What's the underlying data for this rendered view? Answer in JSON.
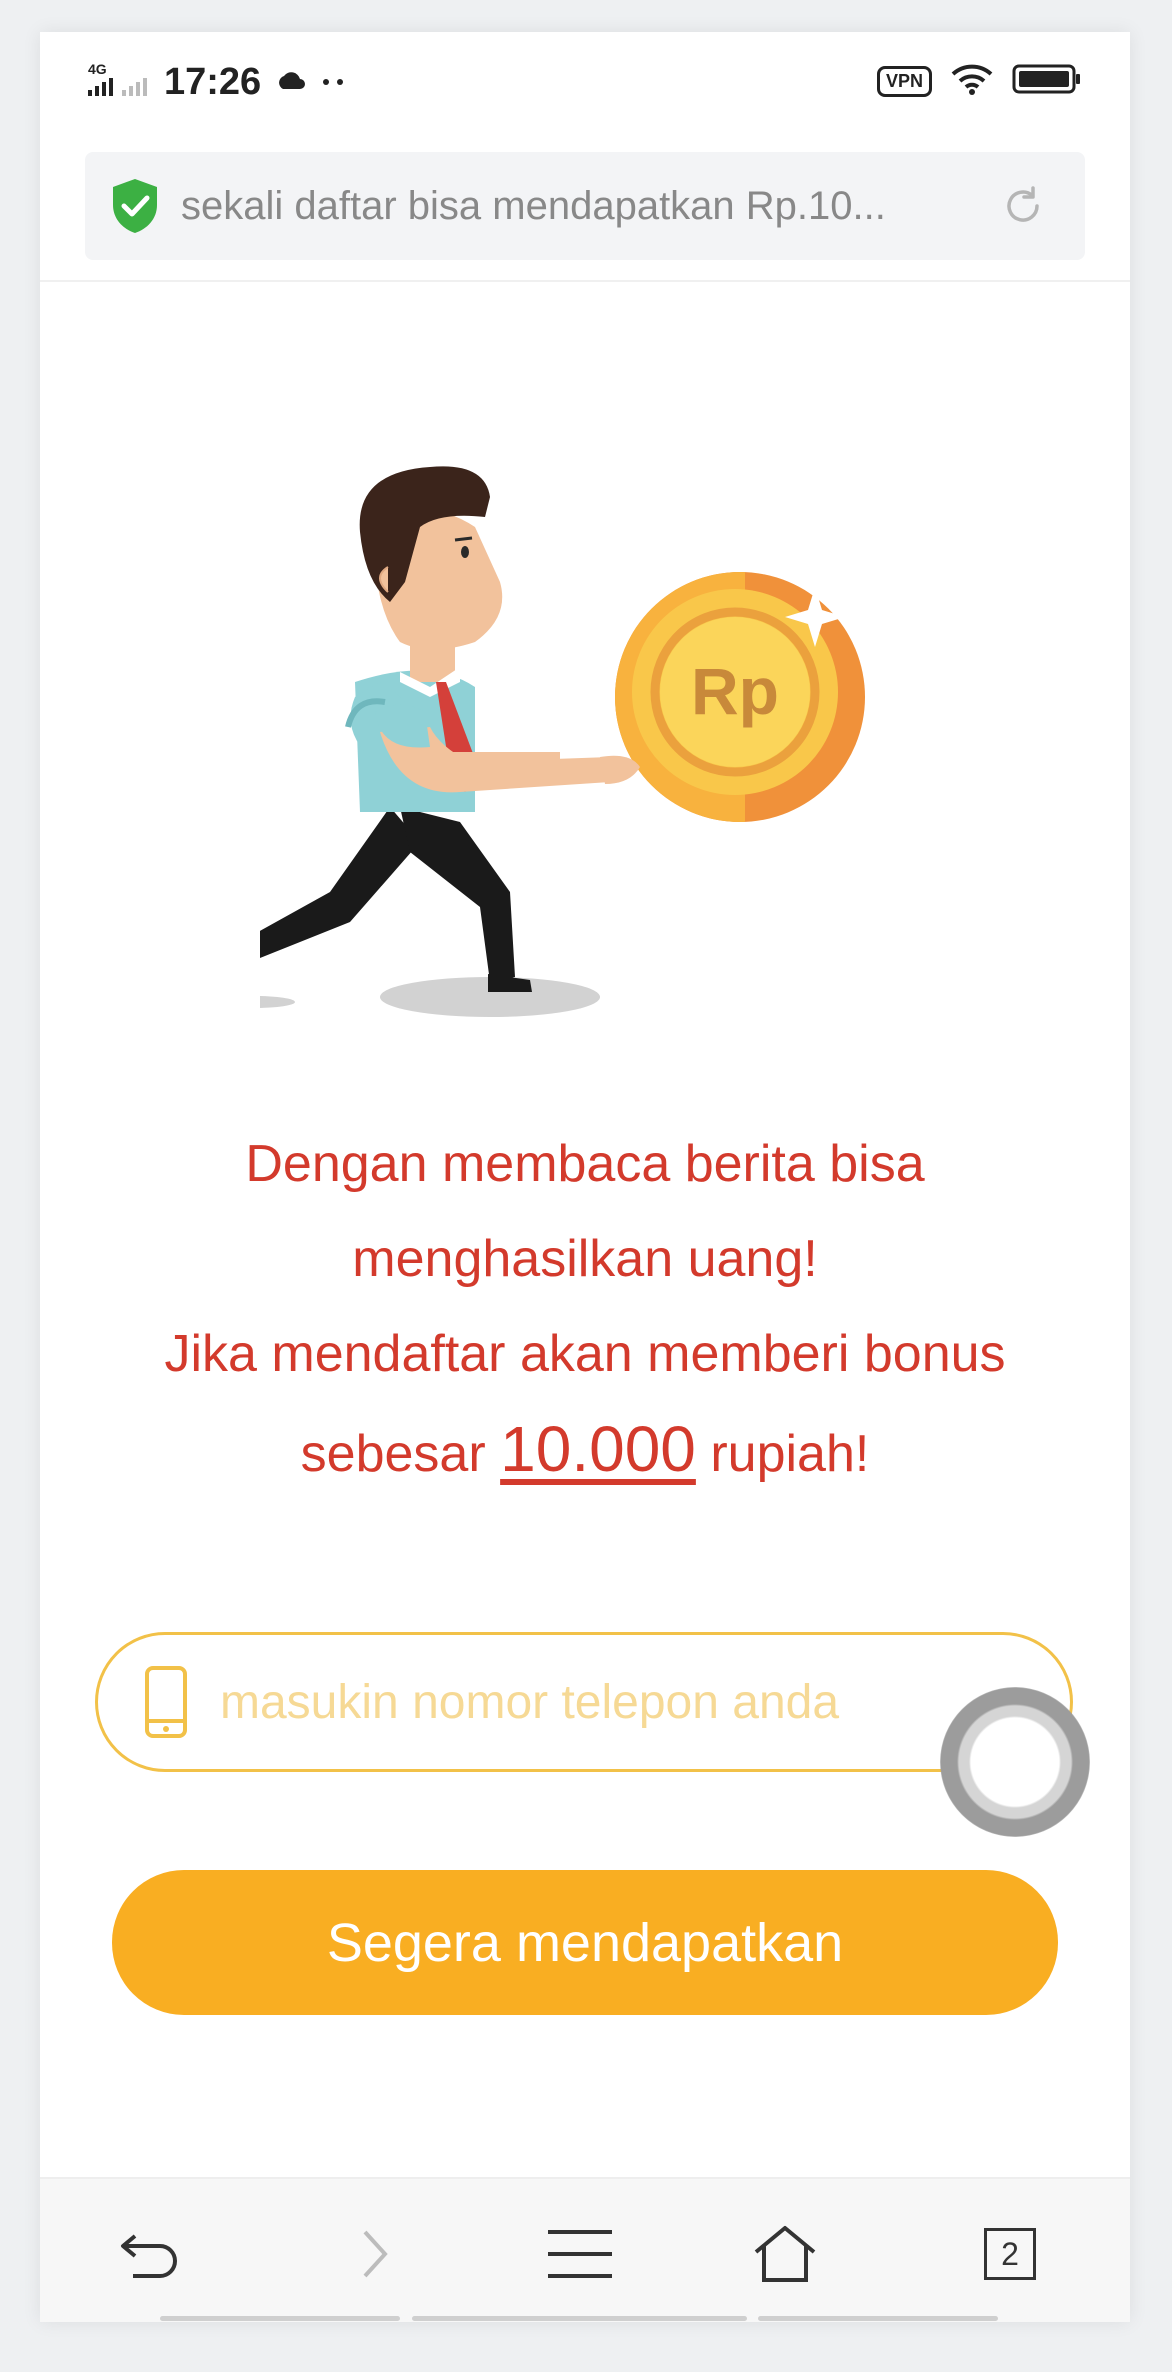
{
  "status_bar": {
    "network": "4G",
    "time": "17:26",
    "vpn_label": "VPN"
  },
  "browser": {
    "url_title": "sekali daftar bisa mendapatkan Rp.10...",
    "tab_count": "2"
  },
  "illustration": {
    "coin_label": "Rp"
  },
  "promo": {
    "line1": "Dengan membaca berita bisa",
    "line2": "menghasilkan uang!",
    "line3": "Jika mendaftar akan memberi bonus",
    "line4_prefix": "sebesar",
    "amount": "10.000",
    "line4_suffix": "rupiah!"
  },
  "form": {
    "phone_placeholder": "masukin nomor telepon anda",
    "submit_label": "Segera mendapatkan"
  },
  "colors": {
    "accent": "#f9ae22",
    "promo_text": "#d33a2c",
    "secure": "#3cb043"
  }
}
